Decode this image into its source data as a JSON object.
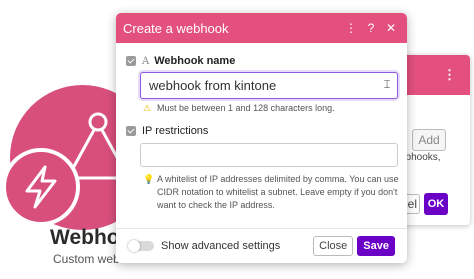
{
  "background_module": {
    "title": "Webhooks",
    "subtitle": "Custom webhook",
    "icon": "webhook-icon",
    "badge_icon": "bolt-icon",
    "brand_color": "#d94f7c"
  },
  "back_dialog": {
    "add_label": "Add",
    "text": "ebhooks,",
    "cancel_label": "Cancel",
    "ok_label": "OK"
  },
  "dialog": {
    "title": "Create a webhook",
    "header_color": "#e4507e",
    "header_buttons": {
      "menu": "⋮",
      "help": "?",
      "close": "✕"
    },
    "fields": {
      "name": {
        "type_icon": "A",
        "label": "Webhook name",
        "value": "webhook from kintone",
        "hint": "Must be between 1 and 128 characters long."
      },
      "ip": {
        "label": "IP restrictions",
        "value": "",
        "hint": "A whitelist of IP addresses delimited by comma. You can use CIDR notation to whitelist a subnet. Leave empty if you don't want to check the IP address."
      }
    },
    "footer": {
      "toggle_label": "Show advanced settings",
      "close_label": "Close",
      "save_label": "Save",
      "accent_color": "#6b00c7"
    }
  }
}
